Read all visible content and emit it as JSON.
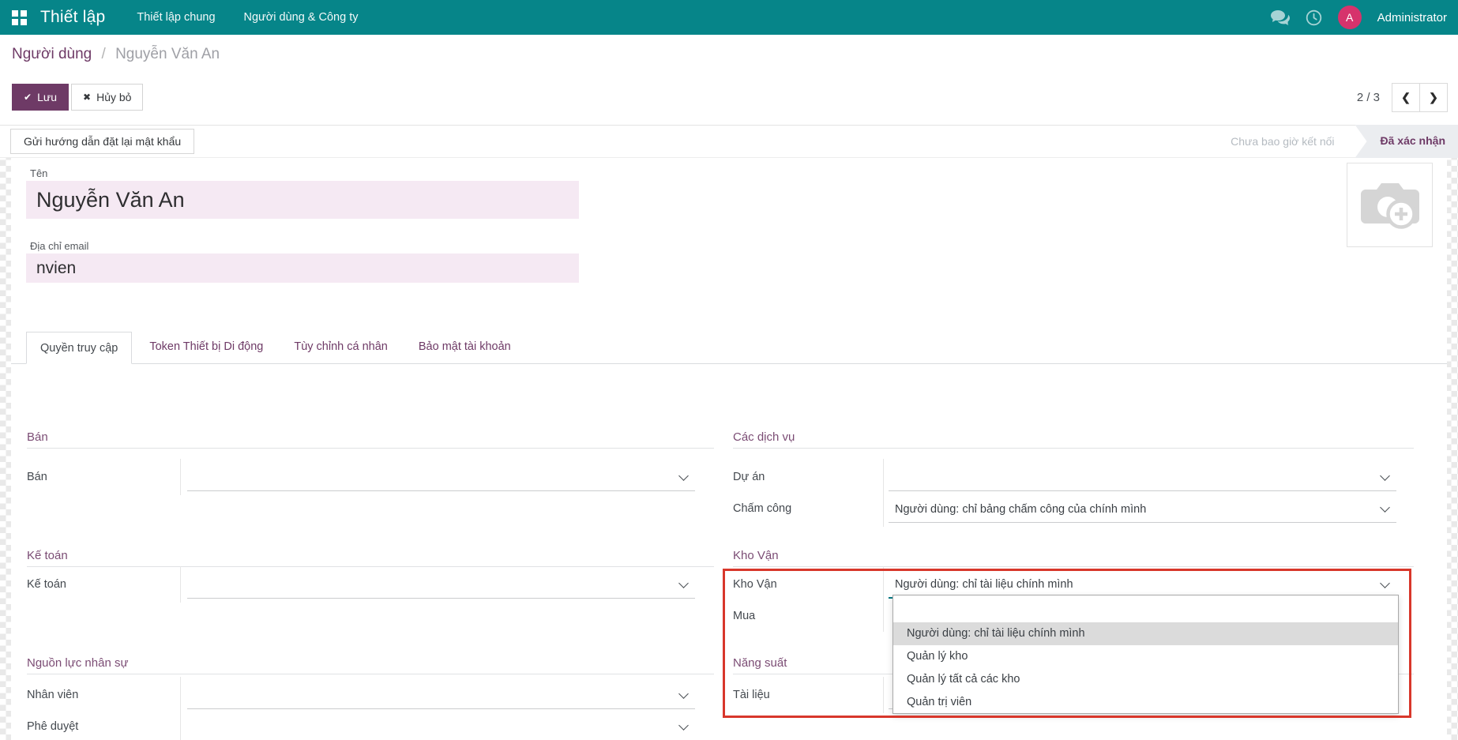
{
  "nav": {
    "app_name": "Thiết lập",
    "menu_items": [
      {
        "label": "Thiết lập chung"
      },
      {
        "label": "Người dùng & Công ty"
      }
    ],
    "user_name": "Administrator",
    "avatar_initial": "A"
  },
  "breadcrumb": {
    "parent": "Người dùng",
    "separator": "/",
    "current": "Nguyễn Văn An"
  },
  "actions": {
    "save": "Lưu",
    "discard": "Hủy bỏ",
    "save_glyph": "✔",
    "discard_glyph": "✖",
    "pager": "2 / 3",
    "prev_glyph": "❮",
    "next_glyph": "❯"
  },
  "statusbar": {
    "reset_password_button": "Gửi hướng dẫn đặt lại mật khẩu",
    "state_inactive": "Chưa bao giờ kết nối",
    "state_active": "Đã xác nhận"
  },
  "profile": {
    "name_label": "Tên",
    "name_value": "Nguyễn Văn An",
    "email_label": "Địa chỉ email",
    "email_value": "nvien"
  },
  "tabs": [
    {
      "label": "Quyền truy cập",
      "active": true
    },
    {
      "label": "Token Thiết bị Di động",
      "active": false
    },
    {
      "label": "Tùy chỉnh cá nhân",
      "active": false
    },
    {
      "label": "Bảo mật tài khoản",
      "active": false
    }
  ],
  "access_rights": {
    "left": [
      {
        "title": "Bán",
        "fields": [
          {
            "label": "Bán",
            "value": ""
          }
        ]
      },
      {
        "title": "Kế toán",
        "fields": [
          {
            "label": "Kế toán",
            "value": ""
          }
        ]
      },
      {
        "title": "Nguồn lực nhân sự",
        "fields": [
          {
            "label": "Nhân viên",
            "value": ""
          },
          {
            "label": "Phê duyệt",
            "value": ""
          }
        ]
      }
    ],
    "right": [
      {
        "title": "Các dịch vụ",
        "fields": [
          {
            "label": "Dự án",
            "value": ""
          },
          {
            "label": "Chấm công",
            "value": "Người dùng: chỉ bảng chấm công của chính mình"
          }
        ]
      },
      {
        "title": "Kho Vận",
        "fields": [
          {
            "label": "Kho Vận",
            "value": "Người dùng: chỉ tài liệu chính mình"
          },
          {
            "label": "Mua",
            "value": ""
          }
        ]
      },
      {
        "title": "Năng suất",
        "fields": [
          {
            "label": "Tài liệu",
            "value": ""
          }
        ]
      }
    ]
  },
  "dropdown": {
    "options": [
      "",
      "Người dùng: chỉ tài liệu chính mình",
      "Quản lý kho",
      "Quản lý tất cả các kho",
      "Quản trị viên"
    ],
    "highlighted": "Người dùng: chỉ tài liệu chính mình"
  },
  "colors": {
    "navbar": "#068589",
    "accent_purple": "#6e3a66",
    "avatar_pink": "#d6336c",
    "field_highlight": "#f5e9f3",
    "annotation_red": "#d8372b"
  }
}
